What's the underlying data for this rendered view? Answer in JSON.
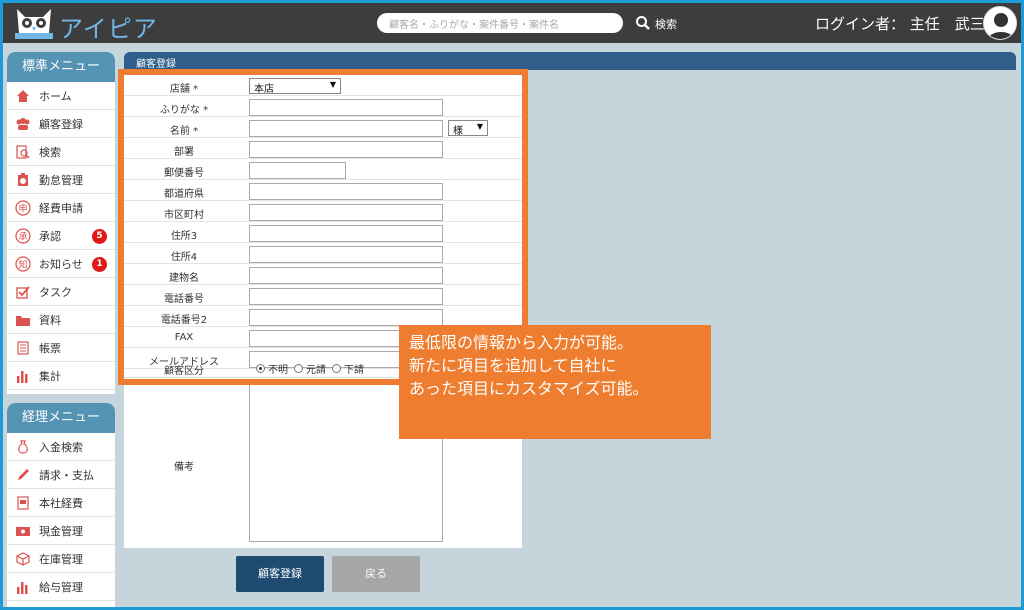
{
  "header": {
    "app_name": "アイピア",
    "search_placeholder": "顧客名・ふりがな・案件番号・案件名",
    "search_button": "検索",
    "login_text": "ログイン者： 主任　武三"
  },
  "sidebar": {
    "standard_title": "標準メニュー",
    "standard_items": [
      {
        "label": "ホーム",
        "icon": "home-icon"
      },
      {
        "label": "顧客登録",
        "icon": "customers-icon"
      },
      {
        "label": "検索",
        "icon": "search-doc-icon"
      },
      {
        "label": "勤怠管理",
        "icon": "timecard-icon"
      },
      {
        "label": "経費申請",
        "icon": "expense-stamp-icon"
      },
      {
        "label": "承認",
        "icon": "approve-stamp-icon",
        "badge": "5"
      },
      {
        "label": "お知らせ",
        "icon": "notice-stamp-icon",
        "badge": "1"
      },
      {
        "label": "タスク",
        "icon": "checkbox-icon"
      },
      {
        "label": "資料",
        "icon": "folder-icon"
      },
      {
        "label": "帳票",
        "icon": "ledger-icon"
      },
      {
        "label": "集計",
        "icon": "bar-chart-icon"
      }
    ],
    "accounting_title": "経理メニュー",
    "accounting_items": [
      {
        "label": "入金検索",
        "icon": "money-bag-icon"
      },
      {
        "label": "請求・支払",
        "icon": "pen-icon"
      },
      {
        "label": "本社経費",
        "icon": "receipt-icon"
      },
      {
        "label": "現金管理",
        "icon": "cash-icon"
      },
      {
        "label": "在庫管理",
        "icon": "box-icon"
      },
      {
        "label": "給与管理",
        "icon": "bar-chart-icon"
      }
    ]
  },
  "main": {
    "title": "顧客登録",
    "fields": [
      {
        "label": "店舗 *",
        "type": "select",
        "value": "本店"
      },
      {
        "label": "ふりがな *",
        "type": "text"
      },
      {
        "label": "名前 *",
        "type": "text_suffix",
        "suffix": "様"
      },
      {
        "label": "部署",
        "type": "text"
      },
      {
        "label": "郵便番号",
        "type": "short"
      },
      {
        "label": "都道府県",
        "type": "text"
      },
      {
        "label": "市区町村",
        "type": "text"
      },
      {
        "label": "住所3",
        "type": "text"
      },
      {
        "label": "住所4",
        "type": "text"
      },
      {
        "label": "建物名",
        "type": "text"
      },
      {
        "label": "電話番号",
        "type": "text"
      },
      {
        "label": "電話番号2",
        "type": "text"
      },
      {
        "label": "FAX",
        "type": "text"
      },
      {
        "label": "メールアドレス",
        "type": "text"
      },
      {
        "label": "顧客区分",
        "type": "radio",
        "options": [
          "不明",
          "元請",
          "下請"
        ],
        "selected": "不明"
      }
    ],
    "note_label": "備考",
    "submit_button": "顧客登録",
    "back_button": "戻る"
  },
  "callout": {
    "line1": "最低限の情報から入力が可能。",
    "line2": "新たに項目を追加して自社に",
    "line3": "あった項目にカスタマイズ可能。"
  },
  "colors": {
    "accent": "#ee7d2f",
    "header_bg": "#3d3d3d",
    "menu_head": "#5593b4",
    "title_bar": "#2f5e8a",
    "badge": "#e01818"
  }
}
